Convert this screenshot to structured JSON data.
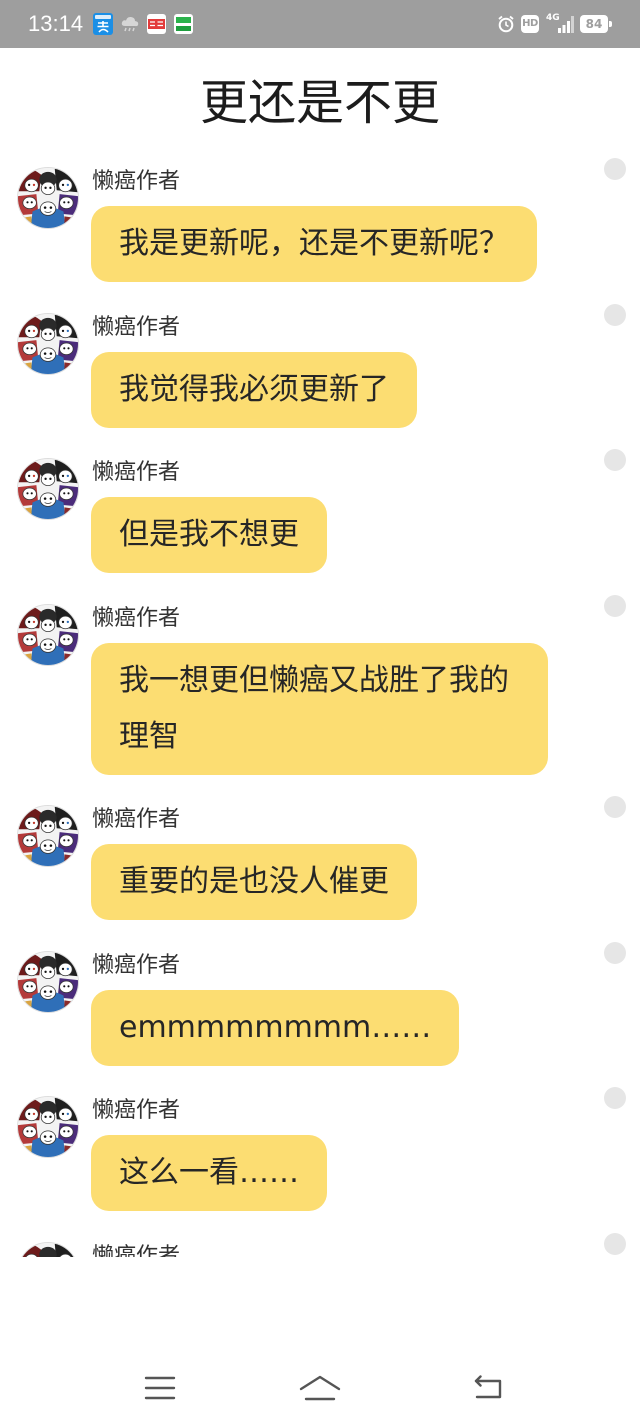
{
  "status_bar": {
    "time": "13:14",
    "hd_label": "HD",
    "network_label": "4G",
    "battery_level": "84",
    "notification_icons": [
      "alipay-icon",
      "cloud-rain-icon",
      "toutiao-icon",
      "green-app-icon"
    ],
    "system_icons": [
      "alarm-icon",
      "hd-icon",
      "signal-4g-icon",
      "battery-icon"
    ],
    "background": "#9e9e9e"
  },
  "header": {
    "title": "更还是不更"
  },
  "messages": [
    {
      "author": "懒癌作者",
      "text": "我是更新呢，还是不更新呢？"
    },
    {
      "author": "懒癌作者",
      "text": "我觉得我必须更新了"
    },
    {
      "author": "懒癌作者",
      "text": "但是我不想更"
    },
    {
      "author": "懒癌作者",
      "text": "我一想更但懒癌又战胜了我的理智"
    },
    {
      "author": "懒癌作者",
      "text": "重要的是也没人催更"
    },
    {
      "author": "懒癌作者",
      "text": "emmmmmmmm……"
    },
    {
      "author": "懒癌作者",
      "text": "这么一看……"
    },
    {
      "author": "懒癌作者"
    }
  ],
  "theme": {
    "bubble_color": "#fcdd72",
    "select_dot_color": "#e6e6e6",
    "text_color": "#262626"
  },
  "nav_bar": {
    "icons": [
      "menu-icon",
      "home-icon",
      "back-icon"
    ]
  }
}
